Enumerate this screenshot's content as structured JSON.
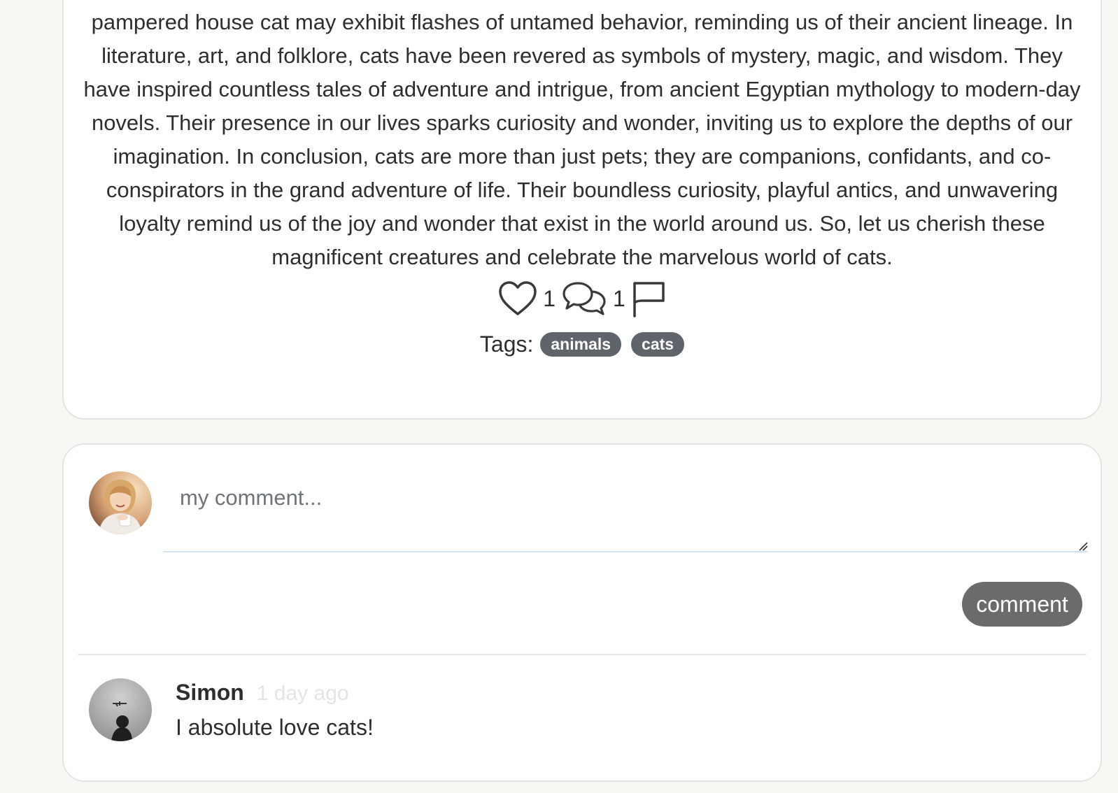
{
  "post": {
    "body": "pampered house cat may exhibit flashes of untamed behavior, reminding us of their ancient lineage. In literature, art, and folklore, cats have been revered as symbols of mystery, magic, and wisdom. They have inspired countless tales of adventure and intrigue, from ancient Egyptian mythology to modern-day novels. Their presence in our lives sparks curiosity and wonder, inviting us to explore the depths of our imagination. In conclusion, cats are more than just pets; they are companions, confidants, and co-conspirators in the grand adventure of life. Their boundless curiosity, playful antics, and unwavering loyalty remind us of the joy and wonder that exist in the world around us. So, let us cherish these magnificent creatures and celebrate the marvelous world of cats.",
    "like_icon": "heart-icon",
    "like_count": "1",
    "comment_icon": "speech-bubbles-icon",
    "comment_count": "1",
    "flag_icon": "flag-icon",
    "tags_label": "Tags:",
    "tags": [
      "animals",
      "cats"
    ]
  },
  "comment_form": {
    "avatar_icon": "user-avatar",
    "placeholder": "my comment...",
    "value": "",
    "submit_label": "comment"
  },
  "comments": [
    {
      "author": "Simon",
      "time": "1 day ago",
      "text": "I absolute love cats!"
    }
  ],
  "colors": {
    "page_bg": "#f8f7f4",
    "card_bg": "#ffffff",
    "tag_bg": "#5e6469",
    "button_bg": "#6b6b6b",
    "input_underline": "#cfe4f2"
  }
}
